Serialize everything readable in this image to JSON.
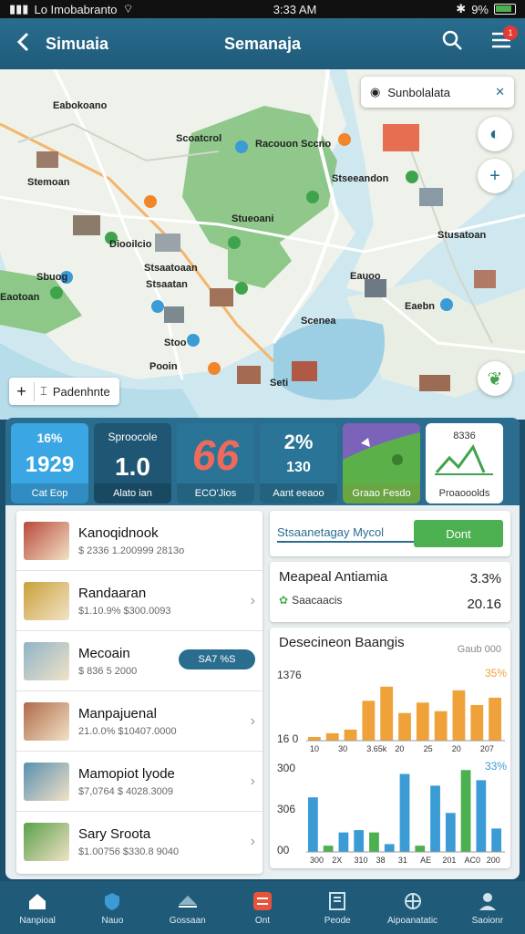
{
  "status_bar": {
    "left": "Lo Imobabranto",
    "time": "3:33 AM",
    "right": "9%"
  },
  "header": {
    "back_icon": "back-arrow-icon",
    "left_title": "Simuaia",
    "center_title": "Semanaja",
    "notification_count": "1"
  },
  "map": {
    "search_text": "Sunbolalata",
    "labels": [
      "Eabokoano",
      "Stemoan",
      "Scoatcrol",
      "Racouon Sccno",
      "Stseeandon",
      "Stueoani",
      "Stusatoan",
      "Stsaatoaan",
      "Sbuog",
      "Eauoo",
      "Eaebn",
      "Eaotoan",
      "Stoo",
      "Pooin",
      "Stsaatan",
      "Scenea",
      "Seti",
      "Diooilcio"
    ],
    "control_label": "Padenhnte"
  },
  "stats": [
    {
      "top": "16%",
      "main": "1929",
      "bottom": "Cat Eop",
      "color": "#3aa6e3"
    },
    {
      "top": "Sproocole",
      "main": "1.0",
      "bottom": "Alato ian",
      "color": "#1e5673"
    },
    {
      "top": "",
      "main": "66",
      "bottom": "ECO'Jios",
      "color": "#2a7597"
    },
    {
      "top": "2%",
      "main": "130",
      "bottom": "Aant eeaoo",
      "color": "#2a7597"
    },
    {
      "top": "",
      "main": "",
      "bottom": "Graao Fesdo",
      "color": "#5a8a3c"
    },
    {
      "top": "8336",
      "main": "",
      "bottom": "Proaooolds",
      "color": "#ffffff"
    }
  ],
  "list": [
    {
      "title": "Kanoqidnook",
      "sub": "$ 2336 1.200999 2813o",
      "color": "#b94a3a"
    },
    {
      "title": "Randaaran",
      "sub": "$1.10.9% $300.0093",
      "color": "#c9a13a"
    },
    {
      "title": "Mecoain",
      "sub": "$ 836 5 2000",
      "color": "#8fb4c8",
      "badge": "SA7 %S"
    },
    {
      "title": "Manpajuenal",
      "sub": "21.0.0% $10407.0000",
      "color": "#b06a4a"
    },
    {
      "title": "Mamopiot lyode",
      "sub": "$7,0764 $ 4028.3009",
      "color": "#5a8fb0"
    },
    {
      "title": "Sary Sroota",
      "sub": "$1.00756 $330.8 9040",
      "color": "#5aa04a"
    }
  ],
  "right": {
    "card1_label": "Stsaanetagay Mycol",
    "card1_button": "Dont",
    "card2_title": "Meapeal Antiamia",
    "card2_value": "3.3%",
    "card2_sub": "Saacaacis",
    "card2_value2": "20.16",
    "card3_title": "Desecineon Baangis",
    "card3_sub": "Gaub 000"
  },
  "chart_data": [
    {
      "type": "bar",
      "title": "",
      "y_labels": [
        "1376",
        "16 0"
      ],
      "top_right_label": "35%",
      "categories": [
        "10",
        "30",
        "3.65k",
        "20",
        "25",
        "20",
        "207"
      ],
      "values": [
        6,
        12,
        18,
        65,
        88,
        45,
        62,
        48,
        82,
        58,
        70
      ],
      "color": "#f0a23a"
    },
    {
      "type": "bar",
      "title": "",
      "y_labels": [
        "300",
        "306",
        "00"
      ],
      "top_right_label": "33%",
      "categories": [
        "300",
        "2X",
        "310",
        "38",
        "31",
        "AE",
        "201",
        "AC0",
        "200"
      ],
      "series": [
        {
          "values": [
            70,
            8,
            25,
            28,
            25,
            10,
            100,
            8,
            85,
            50,
            105,
            92,
            30
          ],
          "color": "#3a9bd5"
        }
      ]
    }
  ],
  "nav": [
    {
      "label": "Nanpioal",
      "icon": "home-icon"
    },
    {
      "label": "Nauo",
      "icon": "shield-icon"
    },
    {
      "label": "Gossaan",
      "icon": "layers-icon"
    },
    {
      "label": "Ont",
      "icon": "grid-icon"
    },
    {
      "label": "Peode",
      "icon": "book-icon"
    },
    {
      "label": "Aipoanatatic",
      "icon": "network-icon"
    },
    {
      "label": "Saoionr",
      "icon": "user-icon"
    }
  ]
}
